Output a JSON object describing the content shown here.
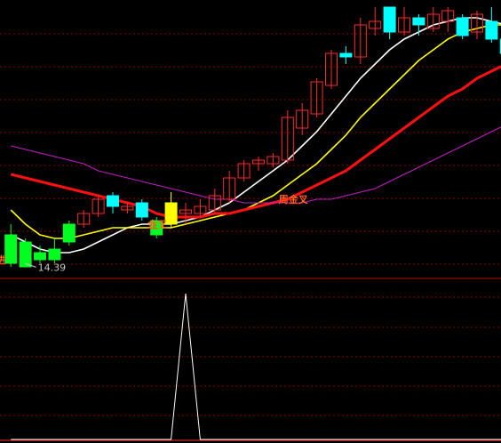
{
  "colors": {
    "background": "#000000",
    "grid": "#8a0000",
    "separator": "#c01010",
    "up_candle": "#ff2a2a",
    "down_candle": "#00ffff",
    "green_candle": "#00ff20",
    "ma_white": "#ffffff",
    "ma_yellow": "#ffff00",
    "ma_red": "#ff1010",
    "ma_magenta": "#c020c0",
    "signal_line": "#ffffff",
    "label_gold": "#ffcc00",
    "low_label": "#c8c8c8"
  },
  "chart_data": [
    {
      "type": "candlestick",
      "panel": "price",
      "title": "",
      "x": [
        1,
        2,
        3,
        4,
        5,
        6,
        7,
        8,
        9,
        10,
        11,
        12,
        13,
        14,
        15,
        16,
        17,
        18,
        19,
        20,
        21,
        22,
        23,
        24,
        25,
        26,
        27,
        28,
        29,
        30,
        31,
        32,
        33,
        34,
        35,
        36
      ],
      "candles": [
        {
          "x": 1,
          "open": 15.3,
          "close": 14.5,
          "high": 15.6,
          "low": 14.4,
          "color": "green"
        },
        {
          "x": 2,
          "open": 15.1,
          "close": 14.4,
          "high": 15.2,
          "low": 14.39,
          "color": "green"
        },
        {
          "x": 3,
          "open": 14.8,
          "close": 14.6,
          "high": 15.0,
          "low": 14.5,
          "color": "green"
        },
        {
          "x": 4,
          "open": 14.6,
          "close": 14.9,
          "high": 15.2,
          "low": 14.5,
          "color": "green"
        },
        {
          "x": 5,
          "open": 15.1,
          "close": 15.6,
          "high": 15.7,
          "low": 15.0,
          "color": "green"
        },
        {
          "x": 6,
          "open": 15.6,
          "close": 15.9,
          "high": 16.0,
          "low": 15.5,
          "color": "red"
        },
        {
          "x": 7,
          "open": 15.9,
          "close": 16.3,
          "high": 16.4,
          "low": 15.8,
          "color": "red"
        },
        {
          "x": 8,
          "open": 16.4,
          "close": 16.1,
          "high": 16.5,
          "low": 15.9,
          "color": "cyan"
        },
        {
          "x": 9,
          "open": 16.0,
          "close": 16.1,
          "high": 16.2,
          "low": 15.9,
          "color": "red"
        },
        {
          "x": 10,
          "open": 16.2,
          "close": 15.8,
          "high": 16.3,
          "low": 15.7,
          "color": "cyan"
        },
        {
          "x": 11,
          "open": 15.7,
          "close": 15.3,
          "high": 15.8,
          "low": 15.2,
          "color": "green"
        },
        {
          "x": 12,
          "open": 15.6,
          "close": 16.2,
          "high": 16.5,
          "low": 15.5,
          "color": "yellow"
        },
        {
          "x": 13,
          "open": 16.0,
          "close": 15.9,
          "high": 16.2,
          "low": 15.6,
          "color": "red"
        },
        {
          "x": 14,
          "open": 15.9,
          "close": 16.1,
          "high": 16.3,
          "low": 15.8,
          "color": "red"
        },
        {
          "x": 15,
          "open": 16.0,
          "close": 16.4,
          "high": 16.6,
          "low": 15.9,
          "color": "red"
        },
        {
          "x": 16,
          "open": 16.3,
          "close": 16.9,
          "high": 17.1,
          "low": 16.2,
          "color": "red"
        },
        {
          "x": 17,
          "open": 16.9,
          "close": 17.3,
          "high": 17.4,
          "low": 16.8,
          "color": "red"
        },
        {
          "x": 18,
          "open": 17.3,
          "close": 17.4,
          "high": 17.5,
          "low": 17.1,
          "color": "red"
        },
        {
          "x": 19,
          "open": 17.3,
          "close": 17.5,
          "high": 17.6,
          "low": 17.2,
          "color": "red"
        },
        {
          "x": 20,
          "open": 17.4,
          "close": 18.6,
          "high": 18.8,
          "low": 17.3,
          "color": "red"
        },
        {
          "x": 21,
          "open": 18.3,
          "close": 18.8,
          "high": 19.0,
          "low": 18.1,
          "color": "red"
        },
        {
          "x": 22,
          "open": 18.7,
          "close": 19.6,
          "high": 19.7,
          "low": 18.6,
          "color": "red"
        },
        {
          "x": 23,
          "open": 19.5,
          "close": 20.4,
          "high": 20.5,
          "low": 19.4,
          "color": "red"
        },
        {
          "x": 24,
          "open": 20.4,
          "close": 20.3,
          "high": 20.6,
          "low": 20.1,
          "color": "cyan"
        },
        {
          "x": 25,
          "open": 20.3,
          "close": 21.2,
          "high": 21.4,
          "low": 20.1,
          "color": "red"
        },
        {
          "x": 26,
          "open": 21.1,
          "close": 21.3,
          "high": 21.7,
          "low": 20.9,
          "color": "red"
        },
        {
          "x": 27,
          "open": 21.7,
          "close": 21.0,
          "high": 21.7,
          "low": 20.8,
          "color": "cyan"
        },
        {
          "x": 28,
          "open": 21.0,
          "close": 21.4,
          "high": 21.7,
          "low": 20.9,
          "color": "red"
        },
        {
          "x": 29,
          "open": 21.4,
          "close": 21.2,
          "high": 21.5,
          "low": 20.9,
          "color": "cyan"
        },
        {
          "x": 30,
          "open": 21.1,
          "close": 21.5,
          "high": 21.7,
          "low": 21.0,
          "color": "red"
        },
        {
          "x": 31,
          "open": 21.3,
          "close": 21.6,
          "high": 21.7,
          "low": 21.0,
          "color": "red"
        },
        {
          "x": 32,
          "open": 21.4,
          "close": 20.9,
          "high": 21.5,
          "low": 20.8,
          "color": "cyan"
        },
        {
          "x": 33,
          "open": 21.5,
          "close": 21.0,
          "high": 21.6,
          "low": 20.8,
          "color": "red"
        },
        {
          "x": 34,
          "open": 21.3,
          "close": 20.8,
          "high": 21.7,
          "low": 20.7,
          "color": "cyan"
        },
        {
          "x": 35,
          "open": 20.8,
          "close": 20.4,
          "high": 21.0,
          "low": 20.2,
          "color": "cyan"
        },
        {
          "x": 36,
          "open": 20.5,
          "close": 20.7,
          "high": 20.9,
          "low": 20.3,
          "color": "red"
        }
      ],
      "series": [
        {
          "color": "#ffffff",
          "values": [
            15.3,
            15.1,
            14.9,
            14.8,
            14.8,
            14.9,
            15.1,
            15.3,
            15.5,
            15.6,
            15.6,
            15.6,
            15.7,
            15.8,
            16.0,
            16.2,
            16.5,
            16.8,
            17.1,
            17.4,
            17.8,
            18.2,
            18.7,
            19.2,
            19.7,
            20.1,
            20.5,
            20.8,
            21.0,
            21.2,
            21.3,
            21.4,
            21.4,
            21.3,
            21.2,
            21.1
          ]
        },
        {
          "color": "#ffff00",
          "values": [
            16.0,
            15.6,
            15.3,
            15.2,
            15.2,
            15.3,
            15.4,
            15.5,
            15.5,
            15.5,
            15.5,
            15.5,
            15.6,
            15.7,
            15.8,
            15.9,
            16.0,
            16.2,
            16.4,
            16.7,
            17.0,
            17.3,
            17.7,
            18.1,
            18.6,
            19.0,
            19.4,
            19.8,
            20.2,
            20.5,
            20.8,
            21.0,
            21.1,
            21.2,
            21.2,
            21.1
          ]
        },
        {
          "color": "#ff1010",
          "values": [
            17.0,
            16.9,
            16.8,
            16.7,
            16.6,
            16.5,
            16.4,
            16.3,
            16.2,
            16.1,
            15.9,
            15.8,
            15.8,
            15.8,
            15.9,
            15.9,
            16.0,
            16.1,
            16.2,
            16.3,
            16.5,
            16.7,
            16.9,
            17.1,
            17.4,
            17.7,
            18.0,
            18.3,
            18.6,
            18.9,
            19.2,
            19.4,
            19.7,
            19.9,
            20.1,
            20.3
          ]
        },
        {
          "color": "#c020c0",
          "values": [
            17.8,
            17.7,
            17.6,
            17.5,
            17.4,
            17.3,
            17.1,
            17.0,
            16.9,
            16.8,
            16.7,
            16.6,
            16.5,
            16.4,
            16.3,
            16.3,
            16.2,
            16.2,
            16.2,
            16.2,
            16.2,
            16.3,
            16.3,
            16.4,
            16.5,
            16.6,
            16.8,
            17.0,
            17.2,
            17.4,
            17.6,
            17.8,
            18.0,
            18.2,
            18.4,
            18.6
          ]
        }
      ],
      "annotations": [
        {
          "text": "14.39",
          "x": 2,
          "y": 14.39,
          "kind": "low-marker"
        },
        {
          "text": "金叉",
          "x": 11,
          "y": 15.6,
          "kind": "signal"
        },
        {
          "text": "周金叉",
          "x": 20,
          "y": 16.3,
          "kind": "signal"
        },
        {
          "text": "进",
          "x": 0.6,
          "y": 14.6,
          "kind": "signal"
        }
      ],
      "ylim": [
        14.1,
        21.9
      ]
    },
    {
      "type": "line",
      "panel": "indicator",
      "title": "",
      "x": [
        1,
        2,
        3,
        4,
        5,
        6,
        7,
        8,
        9,
        10,
        11,
        12,
        13,
        14,
        15,
        16,
        17,
        18,
        19,
        20,
        21,
        22,
        23,
        24,
        25,
        26,
        27,
        28,
        29,
        30,
        31,
        32,
        33,
        34,
        35,
        36
      ],
      "series": [
        {
          "color": "#ffffff",
          "values": [
            0,
            0,
            0,
            0,
            0,
            0,
            0,
            0,
            0,
            0,
            0,
            0,
            1,
            0,
            0,
            0,
            0,
            0,
            0,
            0,
            0,
            0,
            0,
            0,
            0,
            0,
            0,
            0,
            0,
            0,
            0,
            0,
            0,
            0,
            0,
            0
          ]
        }
      ],
      "ylim": [
        0,
        1
      ]
    }
  ]
}
